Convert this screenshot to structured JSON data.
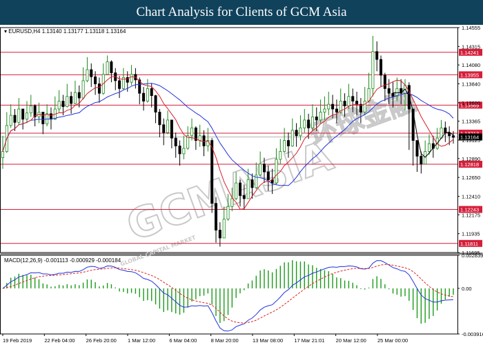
{
  "page": {
    "title": "Chart Analysis for Clients of GCM Asia"
  },
  "watermark": {
    "brand": "GCMASIA",
    "chinese": "环球金融",
    "tagline": "GLOBAL CAPITAL MARKET"
  },
  "chart_data": {
    "type": "line",
    "instrument_label": "EURUSD,H4  1.13140 1.13177 1.13118 1.13164",
    "current_price": 1.13164,
    "ylim": [
      1.11695,
      1.14555
    ],
    "y_ticks": [
      1.14555,
      1.14315,
      1.1408,
      1.1384,
      1.136,
      1.13365,
      1.13125,
      1.1289,
      1.1265,
      1.1241,
      1.12175,
      1.11935,
      1.11695
    ],
    "x_ticks": [
      "19 Feb 2019",
      "22 Feb 04:00",
      "26 Feb 20:00",
      "1 Mar 12:00",
      "6 Mar 04:00",
      "8 Mar 20:00",
      "13 Mar 08:00",
      "17 Mar 21:01",
      "20 Mar 12:00",
      "25 Mar 00:00"
    ],
    "levels": [
      {
        "label": "1.14241",
        "value": 1.14241
      },
      {
        "label": "1.13955",
        "value": 1.13955
      },
      {
        "label": "1.13569",
        "value": 1.13569
      },
      {
        "label": "1.13213",
        "value": 1.13213
      },
      {
        "label": "1.12818",
        "value": 1.12818
      },
      {
        "label": "1.12243",
        "value": 1.12243
      },
      {
        "label": "1.11811",
        "value": 1.11811
      }
    ],
    "close": [
      1.1298,
      1.1331,
      1.1344,
      1.1335,
      1.1352,
      1.1339,
      1.1347,
      1.1356,
      1.1342,
      1.1348,
      1.1333,
      1.1346,
      1.1339,
      1.1352,
      1.1362,
      1.1355,
      1.1368,
      1.1359,
      1.1373,
      1.1366,
      1.1388,
      1.1402,
      1.1393,
      1.1384,
      1.1372,
      1.1396,
      1.1412,
      1.1398,
      1.1388,
      1.1378,
      1.1392,
      1.1386,
      1.1396,
      1.1389,
      1.1372,
      1.1362,
      1.1378,
      1.1369,
      1.1348,
      1.1332,
      1.1322,
      1.1338,
      1.1315,
      1.1305,
      1.1295,
      1.1302,
      1.1318,
      1.1328,
      1.1312,
      1.1318,
      1.1305,
      1.1312,
      1.1232,
      1.1198,
      1.1188,
      1.1212,
      1.1228,
      1.1238,
      1.1258,
      1.1242,
      1.1238,
      1.1262,
      1.1252,
      1.1268,
      1.1282,
      1.1272,
      1.1262,
      1.1258,
      1.1288,
      1.1298,
      1.1312,
      1.1305,
      1.1325,
      1.1318,
      1.1328,
      1.1338,
      1.1328,
      1.1342,
      1.1338,
      1.1348,
      1.1352,
      1.1358,
      1.1352,
      1.1348,
      1.1362,
      1.1356,
      1.1368,
      1.1362,
      1.1358,
      1.1348,
      1.1362,
      1.1378,
      1.1425,
      1.1415,
      1.1395,
      1.1378,
      1.1372,
      1.1368,
      1.1378,
      1.1372,
      1.1382,
      1.1352,
      1.1312,
      1.1292,
      1.1282,
      1.1298,
      1.1308,
      1.1302,
      1.1315,
      1.1328,
      1.1322,
      1.1318,
      1.1316
    ],
    "high": [
      1.1318,
      1.1348,
      1.1358,
      1.1352,
      1.1366,
      1.1352,
      1.1362,
      1.137,
      1.1358,
      1.136,
      1.1348,
      1.1358,
      1.1354,
      1.1368,
      1.1376,
      1.137,
      1.1384,
      1.1374,
      1.1388,
      1.1382,
      1.1405,
      1.1418,
      1.141,
      1.14,
      1.1392,
      1.141,
      1.142,
      1.1414,
      1.1404,
      1.1394,
      1.1404,
      1.14,
      1.1408,
      1.1404,
      1.1392,
      1.138,
      1.139,
      1.1385,
      1.137,
      1.1352,
      1.134,
      1.135,
      1.1335,
      1.1322,
      1.1312,
      1.1318,
      1.133,
      1.134,
      1.133,
      1.1332,
      1.1325,
      1.1328,
      1.1315,
      1.124,
      1.1208,
      1.1228,
      1.1244,
      1.1252,
      1.1272,
      1.1262,
      1.1256,
      1.1276,
      1.127,
      1.1284,
      1.1298,
      1.129,
      1.128,
      1.1276,
      1.1302,
      1.1314,
      1.1328,
      1.1322,
      1.134,
      1.1334,
      1.1344,
      1.1352,
      1.1346,
      1.1358,
      1.1354,
      1.1364,
      1.1368,
      1.1374,
      1.137,
      1.1364,
      1.1378,
      1.1372,
      1.1384,
      1.1378,
      1.1374,
      1.1366,
      1.138,
      1.1398,
      1.1445,
      1.1438,
      1.142,
      1.1398,
      1.139,
      1.1386,
      1.1392,
      1.139,
      1.139,
      1.1386,
      1.134,
      1.1308,
      1.1298,
      1.1312,
      1.132,
      1.1318,
      1.1328,
      1.1338,
      1.1336,
      1.133,
      1.1324
    ],
    "low": [
      1.1276,
      1.1296,
      1.1328,
      1.1324,
      1.1332,
      1.1326,
      1.1334,
      1.1342,
      1.133,
      1.1334,
      1.132,
      1.133,
      1.1326,
      1.1338,
      1.1348,
      1.1344,
      1.1354,
      1.1346,
      1.1358,
      1.1354,
      1.1364,
      1.1386,
      1.138,
      1.137,
      1.136,
      1.137,
      1.1396,
      1.1386,
      1.1376,
      1.1366,
      1.1376,
      1.1374,
      1.1382,
      1.1378,
      1.1358,
      1.135,
      1.136,
      1.1354,
      1.1334,
      1.1316,
      1.1306,
      1.132,
      1.1302,
      1.129,
      1.128,
      1.1288,
      1.13,
      1.1312,
      1.13,
      1.1304,
      1.1292,
      1.1298,
      1.122,
      1.1182,
      1.1177,
      1.1188,
      1.121,
      1.1222,
      1.1236,
      1.1228,
      1.1224,
      1.124,
      1.1238,
      1.125,
      1.1266,
      1.1258,
      1.1248,
      1.1244,
      1.1256,
      1.1282,
      1.1296,
      1.129,
      1.1304,
      1.1304,
      1.1312,
      1.1322,
      1.1314,
      1.1324,
      1.1324,
      1.1334,
      1.1338,
      1.1344,
      1.134,
      1.1334,
      1.1346,
      1.1342,
      1.1352,
      1.1348,
      1.1344,
      1.1334,
      1.1344,
      1.136,
      1.1368,
      1.14,
      1.138,
      1.1362,
      1.1358,
      1.1354,
      1.1362,
      1.1358,
      1.135,
      1.13,
      1.128,
      1.1272,
      1.127,
      1.1284,
      1.1294,
      1.129,
      1.13,
      1.1314,
      1.131,
      1.1306,
      1.1308
    ],
    "macd": {
      "label": "MACD(12,26,9) -0.001113 -0.000929 -0.000184",
      "ylim": [
        -0.003916,
        0.002839
      ],
      "y_ticks": [
        0.002839,
        0.0,
        -0.003916
      ],
      "y_tick_labels": [
        "0.002839",
        "0.00",
        "-0.003916"
      ]
    },
    "series": [
      {
        "name": "Moving Average (Red)",
        "color": "#d81e2a"
      },
      {
        "name": "Moving Average (Blue)",
        "color": "#2233dd"
      },
      {
        "name": "Close (Black)",
        "color": "#000000"
      }
    ]
  }
}
